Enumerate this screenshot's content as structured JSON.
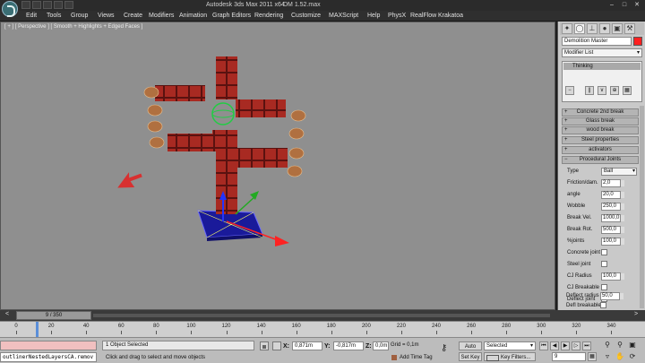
{
  "titlebar": {
    "app_title": "Autodesk 3ds Max  2011 x64",
    "file_name": "DM 1.52.max"
  },
  "menu": [
    "Edit",
    "Tools",
    "Group",
    "Views",
    "Create",
    "Modifiers",
    "Animation",
    "Graph Editors",
    "Rendering",
    "Customize",
    "MAXScript",
    "Help",
    "PhysX",
    "RealFlow",
    "Krakatoa"
  ],
  "viewport": {
    "label": "[ + ] [ Perspective ] [ Smooth + Highlights + Edged Faces ]",
    "background": "#8f8f8f"
  },
  "command_panel": {
    "object_name": "Demolition Master",
    "object_color": "#ff2020",
    "modifier_list": "Modifier List",
    "stack_item": "Thinking",
    "rollouts": [
      {
        "label": "Concrete 2nd break",
        "open": false
      },
      {
        "label": "Glass break",
        "open": false
      },
      {
        "label": "wood break",
        "open": false
      },
      {
        "label": "Steel properties",
        "open": false
      },
      {
        "label": "activators",
        "open": false
      },
      {
        "label": "Procedural Joints",
        "open": true
      }
    ],
    "properties": {
      "type_label": "Type",
      "type_value": "Ball",
      "spinners": [
        {
          "label": "Friction/dam.",
          "value": "2,0"
        },
        {
          "label": "angle",
          "value": "20,0"
        },
        {
          "label": "Wobble",
          "value": "250,0"
        },
        {
          "label": "Break Vel.",
          "value": "1000,0"
        },
        {
          "label": "Break Rot.",
          "value": "500,0"
        },
        {
          "label": "%joints",
          "value": "100,0"
        }
      ],
      "concrete_joint": "Concrete joint",
      "steel_joint": "Steel joint",
      "cj_radius_label": "CJ Radius",
      "cj_radius_value": "100,0",
      "cj_breakable": "CJ Breakable",
      "deflect_joint": "Deflect joint",
      "deflect_radius_label": "Deflect radius",
      "deflect_radius_value": "50,0",
      "defl_breakable": "Defl breakable"
    }
  },
  "timeline": {
    "frame_display": "9 / 350",
    "prev_arrow": "<",
    "next_arrow": ">",
    "ticks": [
      "0",
      "20",
      "40",
      "60",
      "80",
      "100",
      "120",
      "140",
      "160",
      "180",
      "200",
      "220",
      "240",
      "260",
      "280",
      "300",
      "320",
      "340"
    ]
  },
  "status": {
    "script_path": "outlinerNestedLayersCA.remov",
    "selection_info": "1 Object Selected",
    "prompt": "Click and drag to select and move objects",
    "x_label": "X:",
    "x_value": "0,871m",
    "y_label": "Y:",
    "y_value": "-0,817m",
    "z_label": "Z:",
    "z_value": "0,0m",
    "grid": "Grid = 0,1m",
    "add_time_tag": "Add Time Tag",
    "auto_key": "Auto Key",
    "set_key": "Set Key",
    "selected_option": "Selected",
    "key_filters": "Key Filters...",
    "current_frame": "9"
  }
}
